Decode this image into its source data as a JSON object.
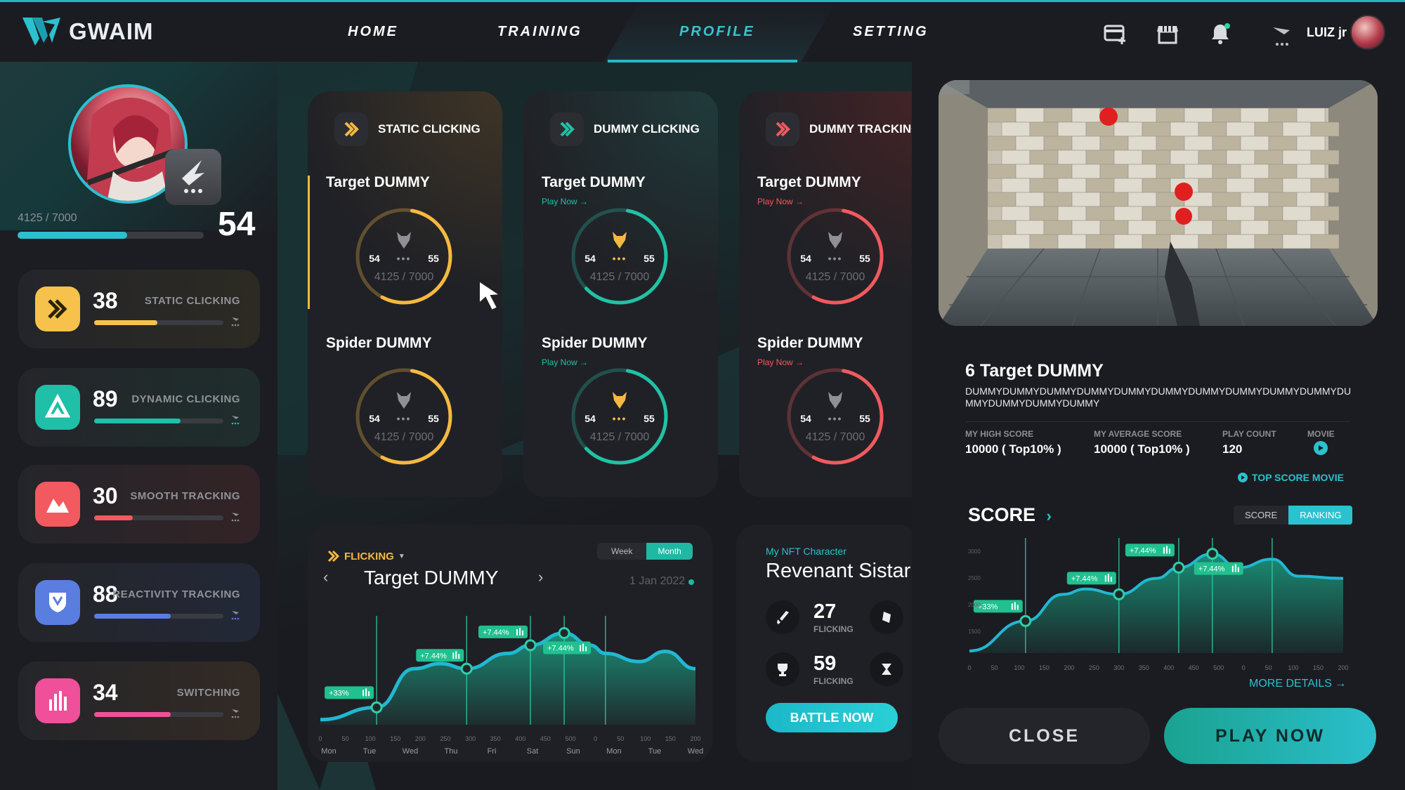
{
  "app": {
    "name": "GWAIM"
  },
  "nav": [
    {
      "label": "HOME"
    },
    {
      "label": "TRAINING"
    },
    {
      "label": "PROFILE"
    },
    {
      "label": "SETTING"
    }
  ],
  "user": {
    "name": "LUIZ jr"
  },
  "profile": {
    "xp_text": "4125 / 7000",
    "xp_fraction": 0.59,
    "level": "54"
  },
  "stats": [
    {
      "value": "38",
      "label": "STATIC CLICKING",
      "color": "#f7c24b",
      "fill": 0.49
    },
    {
      "value": "89",
      "label": "DYNAMIC CLICKING",
      "color": "#1fbfa8",
      "fill": 0.67
    },
    {
      "value": "30",
      "label": "SMOOTH TRACKING",
      "color": "#f25a5f",
      "fill": 0.3
    },
    {
      "value": "88",
      "label": "REACTIVITY TRACKING",
      "color": "#5a7de0",
      "fill": 0.59
    },
    {
      "value": "34",
      "label": "SWITCHING",
      "color": "#f0509a",
      "fill": 0.59
    }
  ],
  "cards": [
    {
      "title": "STATIC CLICKING",
      "color": "#f5b941",
      "targets": [
        {
          "name": "Target DUMMY",
          "left": "54",
          "right": "55",
          "xp": "4125 / 7000",
          "fraction": 0.55
        },
        {
          "name": "Spider DUMMY",
          "left": "54",
          "right": "55",
          "xp": "4125 / 7000",
          "fraction": 0.55
        }
      ]
    },
    {
      "title": "DUMMY CLICKING",
      "color": "#22c1a6",
      "play": "Play Now →",
      "targets": [
        {
          "name": "Target DUMMY",
          "left": "54",
          "right": "55",
          "xp": "4125 / 7000",
          "fraction": 0.6
        },
        {
          "name": "Spider DUMMY",
          "left": "54",
          "right": "55",
          "xp": "4125 / 7000",
          "fraction": 0.6
        }
      ]
    },
    {
      "title": "DUMMY TRACKING",
      "color": "#f05a5e",
      "play": "Play Now →",
      "targets": [
        {
          "name": "Target DUMMY",
          "left": "54",
          "right": "55",
          "xp": "4125 / 7000",
          "fraction": 0.55
        },
        {
          "name": "Spider DUMMY",
          "left": "54",
          "right": "55",
          "xp": "4125 / 7000",
          "fraction": 0.55
        }
      ]
    }
  ],
  "flick_chart": {
    "category": "FLICKING",
    "title": "Target DUMMY",
    "date": "1 Jan 2022",
    "toggle": [
      "Week",
      "Month"
    ],
    "active_toggle": "Month",
    "tags": [
      "+33%",
      "+7.44%",
      "+7.44%",
      "+7.44%"
    ],
    "day_labels": [
      "Mon",
      "Tue",
      "Wed",
      "Thu",
      "Fri",
      "Sat",
      "Sun",
      "Mon",
      "Tue",
      "Wed"
    ],
    "tick_labels": [
      "0",
      "50",
      "100",
      "150",
      "200",
      "250",
      "300",
      "350",
      "400",
      "450",
      "500",
      "0",
      "50",
      "100",
      "150",
      "200"
    ]
  },
  "nft": {
    "label": "My NFT Character",
    "name": "Revenant Sistar",
    "stats": [
      {
        "value": "27",
        "label": "FLICKING"
      },
      {
        "value": "59",
        "label": "FLICKING"
      }
    ],
    "button": "BATTLE NOW"
  },
  "detail": {
    "title": "6 Target DUMMY",
    "desc": "DUMMYDUMMYDUMMYDUMMYDUMMYDUMMYDUMMYDUMMYDUMMYDUMMYDUMMYDUMMYDUMMYDUMMY",
    "metrics": [
      {
        "label": "MY HIGH SCORE",
        "value": "10000 ( Top10% )"
      },
      {
        "label": "MY AVERAGE SCORE",
        "value": "10000 ( Top10% )"
      },
      {
        "label": "PLAY COUNT",
        "value": "120"
      },
      {
        "label": "MOVIE",
        "value": ""
      }
    ],
    "top_movie": "TOP SCORE MOVIE",
    "score_title": "SCORE",
    "score_toggle": [
      "SCORE",
      "RANKING"
    ],
    "active_score_toggle": "RANKING",
    "score_tags": [
      "+33%",
      "+7.44%",
      "+7.44%",
      "+7.44%"
    ],
    "score_y_ticks": [
      "3000",
      "2500",
      "2000",
      "1500"
    ],
    "score_x_ticks": [
      "0",
      "50",
      "100",
      "150",
      "200",
      "250",
      "300",
      "350",
      "400",
      "450",
      "500",
      "0",
      "50",
      "100",
      "150",
      "200"
    ],
    "more_details": "MORE DETAILS →",
    "close": "CLOSE",
    "play": "PLAY NOW"
  }
}
